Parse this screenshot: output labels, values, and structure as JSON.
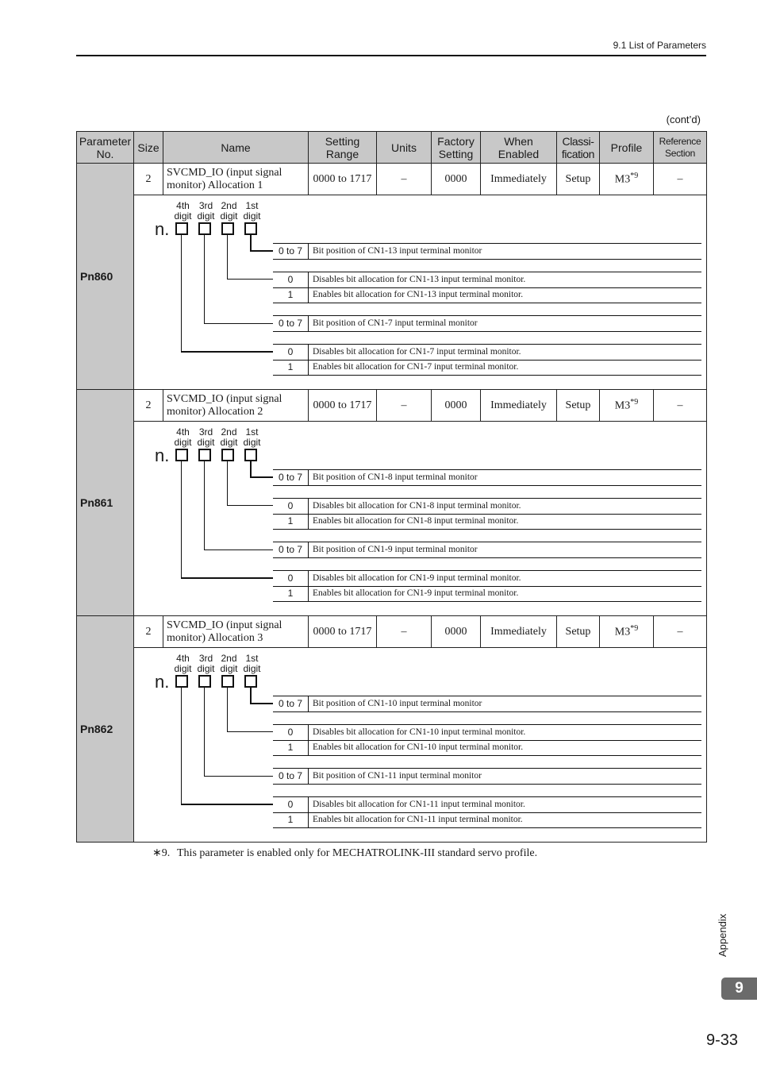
{
  "header": {
    "section_title": "9.1  List of Parameters"
  },
  "contd": "(cont’d)",
  "table": {
    "columns": [
      "Parameter No.",
      "Size",
      "Name",
      "Setting Range",
      "Units",
      "Factory Setting",
      "When Enabled",
      "Classi-fication",
      "Profile",
      "Reference Section"
    ],
    "column_lines": {
      "param_no": [
        "Parameter",
        "No."
      ],
      "setting_range": [
        "Setting",
        "Range"
      ],
      "factory_setting": [
        "Factory",
        "Setting"
      ],
      "when_enabled": [
        "When",
        "Enabled"
      ],
      "classification": [
        "Classi-",
        "fication"
      ],
      "reference": [
        "Reference",
        "Section"
      ]
    },
    "rows": [
      {
        "param_no": "Pn860",
        "size": "2",
        "name_line1": "SVCMD_IO (input signal",
        "name_line2": "monitor) Allocation 1",
        "setting_range": "0000 to 1717",
        "units": "–",
        "factory_setting": "0000",
        "when_enabled": "Immediately",
        "classification": "Setup",
        "profile": "M3",
        "profile_note": "*9",
        "reference": "–",
        "diagram": {
          "digit_labels": [
            "4th digit",
            "3rd digit",
            "2nd digit",
            "1st digit"
          ],
          "prefix": "n.",
          "options": [
            {
              "value": "0 to 7",
              "desc": "Bit position of CN1-13 input terminal monitor"
            },
            {
              "value": "0",
              "desc": "Disables bit allocation for CN1-13 input terminal monitor."
            },
            {
              "value": "1",
              "desc": "Enables bit allocation for CN1-13 input terminal monitor."
            },
            {
              "value": "0 to 7",
              "desc": "Bit position of CN1-7 input terminal monitor"
            },
            {
              "value": "0",
              "desc": "Disables bit allocation for CN1-7 input terminal monitor."
            },
            {
              "value": "1",
              "desc": "Enables bit allocation for CN1-7 input terminal monitor."
            }
          ]
        }
      },
      {
        "param_no": "Pn861",
        "size": "2",
        "name_line1": "SVCMD_IO (input signal",
        "name_line2": "monitor) Allocation 2",
        "setting_range": "0000 to 1717",
        "units": "–",
        "factory_setting": "0000",
        "when_enabled": "Immediately",
        "classification": "Setup",
        "profile": "M3",
        "profile_note": "*9",
        "reference": "–",
        "diagram": {
          "digit_labels": [
            "4th digit",
            "3rd digit",
            "2nd digit",
            "1st digit"
          ],
          "prefix": "n.",
          "options": [
            {
              "value": "0 to 7",
              "desc": "Bit position of CN1-8 input terminal monitor"
            },
            {
              "value": "0",
              "desc": "Disables bit allocation for CN1-8 input terminal monitor."
            },
            {
              "value": "1",
              "desc": "Enables bit allocation for CN1-8 input terminal monitor."
            },
            {
              "value": "0 to 7",
              "desc": "Bit position of CN1-9 input terminal monitor"
            },
            {
              "value": "0",
              "desc": "Disables bit allocation for CN1-9 input terminal monitor."
            },
            {
              "value": "1",
              "desc": "Enables bit allocation for CN1-9 input terminal monitor."
            }
          ]
        }
      },
      {
        "param_no": "Pn862",
        "size": "2",
        "name_line1": "SVCMD_IO (input signal",
        "name_line2": "monitor) Allocation 3",
        "setting_range": "0000 to 1717",
        "units": "–",
        "factory_setting": "0000",
        "when_enabled": "Immediately",
        "classification": "Setup",
        "profile": "M3",
        "profile_note": "*9",
        "reference": "–",
        "diagram": {
          "digit_labels": [
            "4th digit",
            "3rd digit",
            "2nd digit",
            "1st digit"
          ],
          "prefix": "n.",
          "options": [
            {
              "value": "0 to 7",
              "desc": "Bit position of CN1-10 input terminal monitor"
            },
            {
              "value": "0",
              "desc": "Disables bit allocation for CN1-10 input terminal monitor."
            },
            {
              "value": "1",
              "desc": "Enables bit allocation for CN1-10 input terminal monitor."
            },
            {
              "value": "0 to 7",
              "desc": "Bit position of CN1-11 input terminal monitor"
            },
            {
              "value": "0",
              "desc": "Disables bit allocation for CN1-11 input terminal monitor."
            },
            {
              "value": "1",
              "desc": "Enables bit allocation for CN1-11 input terminal monitor."
            }
          ]
        }
      }
    ]
  },
  "footnote": {
    "mark": "∗9.",
    "text": "This parameter is enabled only for MECHATROLINK-III standard servo profile."
  },
  "side_label": "Appendix",
  "chapter_tab": "9",
  "page_number": "9-33",
  "colors": {
    "header_fill": "#c8c8c8",
    "chapter_tab": "#6b6b6b"
  }
}
